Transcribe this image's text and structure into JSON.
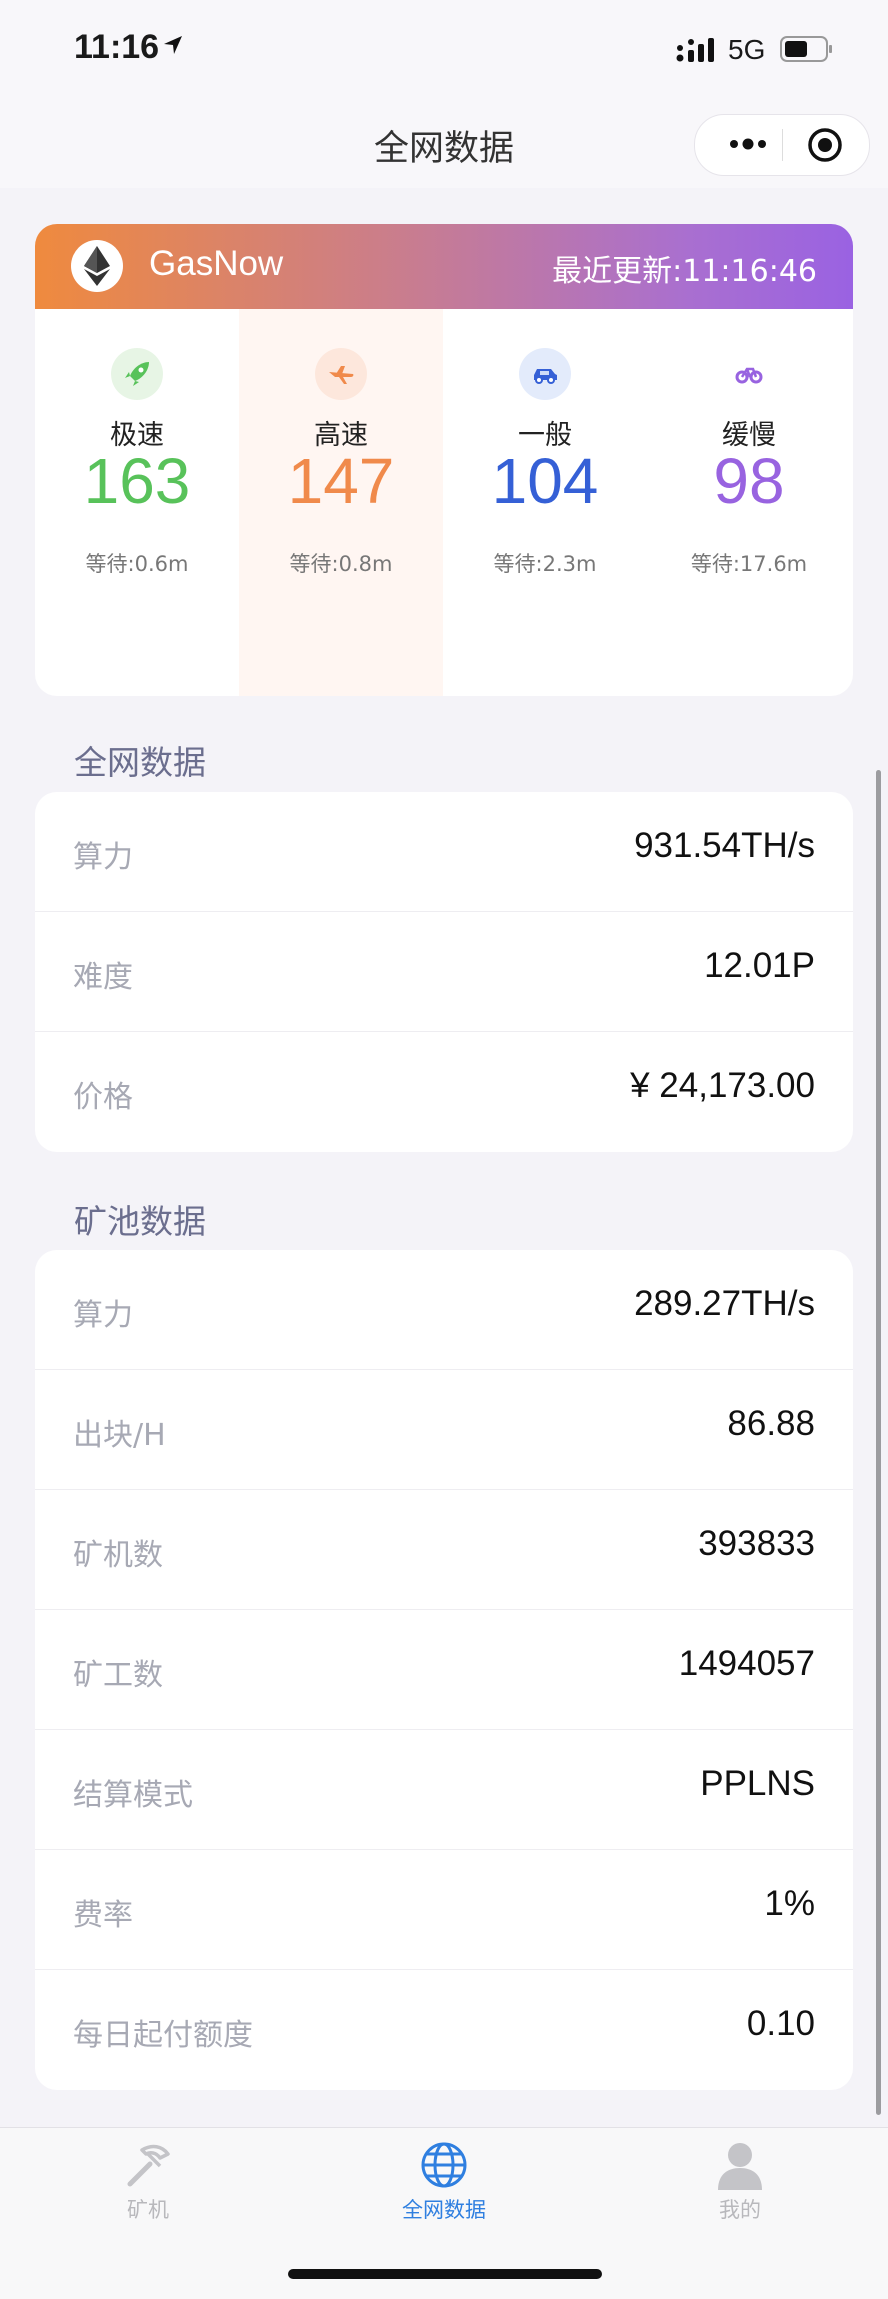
{
  "status_bar": {
    "time": "11:16",
    "network": "5G"
  },
  "nav": {
    "title": "全网数据"
  },
  "gas": {
    "brand": "GasNow",
    "updated": "最近更新:11:16:46",
    "levels": [
      {
        "label": "极速",
        "value": "163",
        "wait": "等待:0.6m",
        "icon": "rocket-icon",
        "color": "#58c25a"
      },
      {
        "label": "高速",
        "value": "147",
        "wait": "等待:0.8m",
        "icon": "airplane-icon",
        "color": "#f08a4b"
      },
      {
        "label": "一般",
        "value": "104",
        "wait": "等待:2.3m",
        "icon": "car-icon",
        "color": "#3560d6"
      },
      {
        "label": "缓慢",
        "value": "98",
        "wait": "等待:17.6m",
        "icon": "bicycle-icon",
        "color": "#9863e0"
      }
    ]
  },
  "network_data": {
    "title": "全网数据",
    "rows": [
      {
        "label": "算力",
        "value": "931.54TH/s"
      },
      {
        "label": "难度",
        "value": "12.01P"
      },
      {
        "label": "价格",
        "value": "¥ 24,173.00"
      }
    ]
  },
  "pool_data": {
    "title": "矿池数据",
    "rows": [
      {
        "label": "算力",
        "value": "289.27TH/s"
      },
      {
        "label": "出块/H",
        "value": "86.88"
      },
      {
        "label": "矿机数",
        "value": "393833"
      },
      {
        "label": "矿工数",
        "value": "1494057"
      },
      {
        "label": "结算模式",
        "value": "PPLNS"
      },
      {
        "label": "费率",
        "value": "1%"
      },
      {
        "label": "每日起付额度",
        "value": "0.10"
      }
    ]
  },
  "tabs": [
    {
      "label": "矿机",
      "icon": "pickaxe-icon",
      "active": false
    },
    {
      "label": "全网数据",
      "icon": "globe-icon",
      "active": true
    },
    {
      "label": "我的",
      "icon": "user-icon",
      "active": false
    }
  ],
  "colors": {
    "active_tab": "#2f7fe0",
    "inactive_tab": "#b8b8bc",
    "selected_gas_bg": "#fff6f2"
  }
}
